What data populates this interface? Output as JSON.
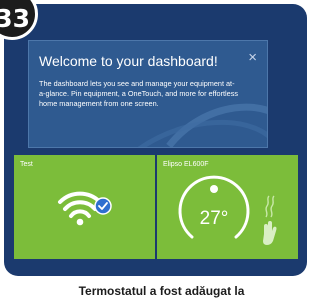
{
  "step_badge": "33",
  "welcome": {
    "title": "Welcome to your dashboard!",
    "body": "The dashboard lets you see and manage your equipment at-a-glance. Pin equipment, a OneTouch, and more for effortless home management from one screen.",
    "close_icon": "×"
  },
  "tiles": [
    {
      "label": "Test",
      "icon": "wifi-icon",
      "status_icon": "check-badge-icon"
    },
    {
      "label": "Elipso EL600F",
      "temperature": "27°",
      "icons": [
        "heat-waves-icon",
        "hand-icon"
      ]
    }
  ],
  "caption": "Termostatul a fost adăugat la",
  "colors": {
    "screen": "#1b3a6e",
    "banner": "#2f5a90",
    "tile": "#7cbd3a",
    "check": "#2f6fd0"
  }
}
